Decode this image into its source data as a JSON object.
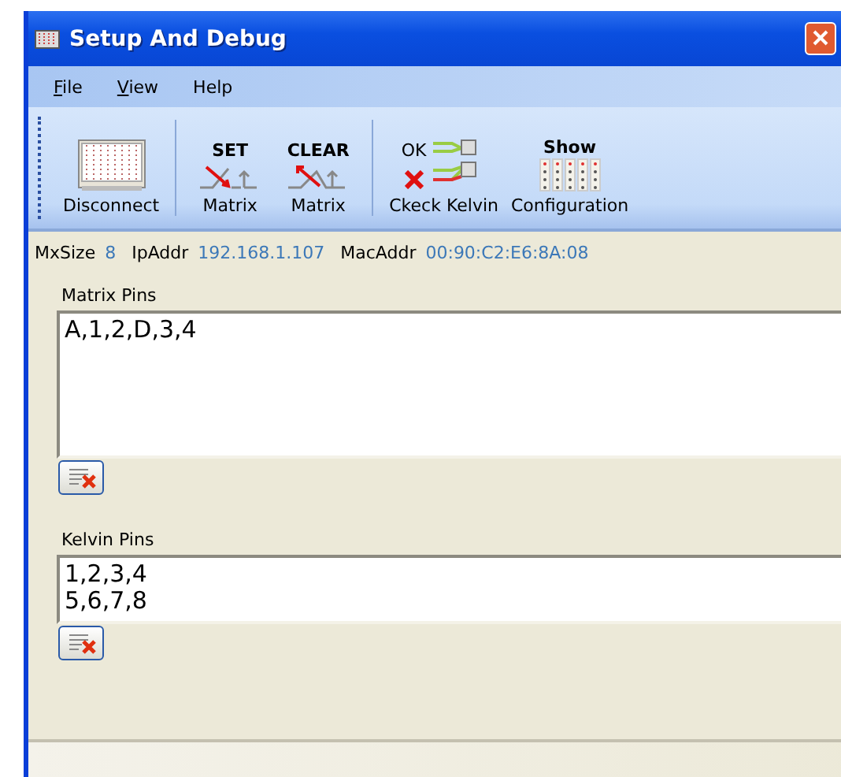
{
  "window": {
    "title": "Setup And Debug"
  },
  "menu": [
    {
      "label": "File",
      "underlined": true
    },
    {
      "label": "View",
      "underlined": true
    },
    {
      "label": "Help",
      "underlined": false
    }
  ],
  "toolbar": [
    {
      "kind": "rack",
      "label": "Disconnect"
    },
    {
      "kind": "separator"
    },
    {
      "kind": "set",
      "caption": "SET",
      "label": "Matrix"
    },
    {
      "kind": "clear",
      "caption": "CLEAR",
      "label": "Matrix"
    },
    {
      "kind": "separator"
    },
    {
      "kind": "kelvin",
      "caption": "OK",
      "label": "Ckeck Kelvin"
    },
    {
      "kind": "config",
      "caption": "Show",
      "label": "Configuration"
    }
  ],
  "info": [
    {
      "label": "MxSize",
      "value": "8"
    },
    {
      "label": "IpAddr",
      "value": "192.168.1.107"
    },
    {
      "label": "MacAddr",
      "value": "00:90:C2:E6:8A:08"
    }
  ],
  "fields": [
    {
      "label": "Matrix Pins",
      "value": "A,1,2,D,3,4",
      "kind": "tall"
    },
    {
      "label": "Kelvin Pins",
      "value": "1,2,3,4\n5,6,7,8",
      "kind": "short"
    }
  ]
}
